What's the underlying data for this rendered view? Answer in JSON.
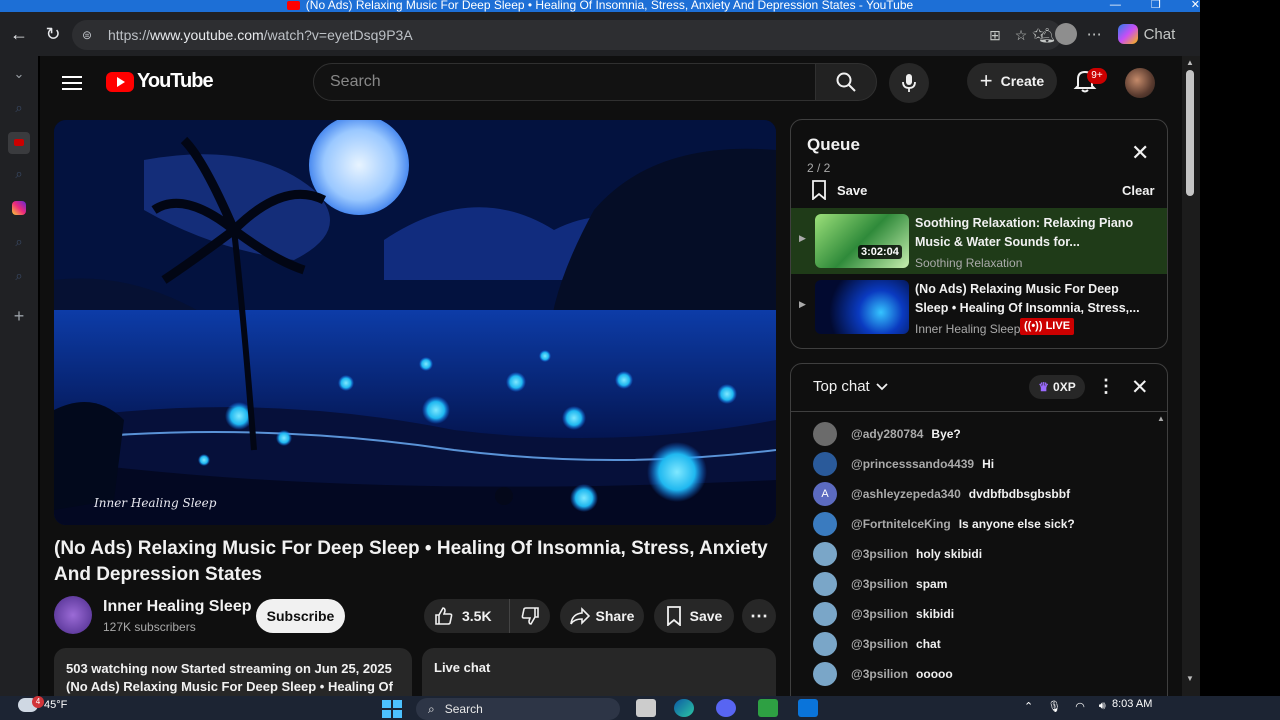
{
  "window": {
    "title": "(No Ads) Relaxing Music For Deep Sleep • Healing Of Insomnia, Stress, Anxiety And Depression States - YouTube",
    "min_icon": "minimize-icon",
    "restore_icon": "restore-icon",
    "close_icon": "close-icon"
  },
  "browser": {
    "url_prefix": "https://",
    "url_host": "www.youtube.com",
    "url_path": "/watch?v=eyetDsq9P3A",
    "copilot_label": "Chat"
  },
  "youtube": {
    "logo_text": "YouTube",
    "search_placeholder": "Search",
    "create_label": "Create",
    "notification_count": "9+"
  },
  "video": {
    "title": "(No Ads) Relaxing Music For Deep Sleep • Healing Of Insomnia, Stress, Anxiety And Depression States",
    "watermark": "Inner Healing Sleep",
    "channel_name": "Inner Healing Sleep",
    "subscribers": "127K subscribers",
    "subscribe_label": "Subscribe",
    "likes": "3.5K",
    "share_label": "Share",
    "save_label": "Save",
    "desc_line1": "503 watching now  Started streaming on Jun 25, 2025",
    "desc_line2": "(No Ads) Relaxing Music For Deep Sleep • Healing Of",
    "live_chat_label": "Live chat"
  },
  "queue": {
    "title": "Queue",
    "count": "2 / 2",
    "save_label": "Save",
    "clear_label": "Clear",
    "items": [
      {
        "title": "Soothing Relaxation: Relaxing Piano Music & Water Sounds for...",
        "channel": "Soothing Relaxation",
        "duration": "3:02:04"
      },
      {
        "title": "(No Ads) Relaxing Music For Deep Sleep • Healing Of Insomnia, Stress,...",
        "channel": "Inner Healing Sleep",
        "live": "LIVE"
      }
    ]
  },
  "chat": {
    "mode_label": "Top chat",
    "xp_label": "0XP",
    "messages": [
      {
        "author": "@ady280784",
        "text": "Bye?",
        "color": "#6b6b6b"
      },
      {
        "author": "@princesssando4439",
        "text": "Hi",
        "color": "#2a5a9a"
      },
      {
        "author": "@ashleyzepeda340",
        "text": "dvdbfbdbsgbsbbf",
        "color": "#5c6bc0",
        "initial": "A"
      },
      {
        "author": "@FortniteIceKing",
        "text": "Is anyone else sick?",
        "color": "#3a7bbf"
      },
      {
        "author": "@3psilion",
        "text": "holy skibidi",
        "color": "#7aa6c8"
      },
      {
        "author": "@3psilion",
        "text": "spam",
        "color": "#7aa6c8"
      },
      {
        "author": "@3psilion",
        "text": "skibidi",
        "color": "#7aa6c8"
      },
      {
        "author": "@3psilion",
        "text": "chat",
        "color": "#7aa6c8"
      },
      {
        "author": "@3psilion",
        "text": "ooooo",
        "color": "#7aa6c8"
      }
    ]
  },
  "taskbar": {
    "temperature": "45°F",
    "weather_badge": "4",
    "search_label": "Search",
    "time": "8:03 AM"
  }
}
